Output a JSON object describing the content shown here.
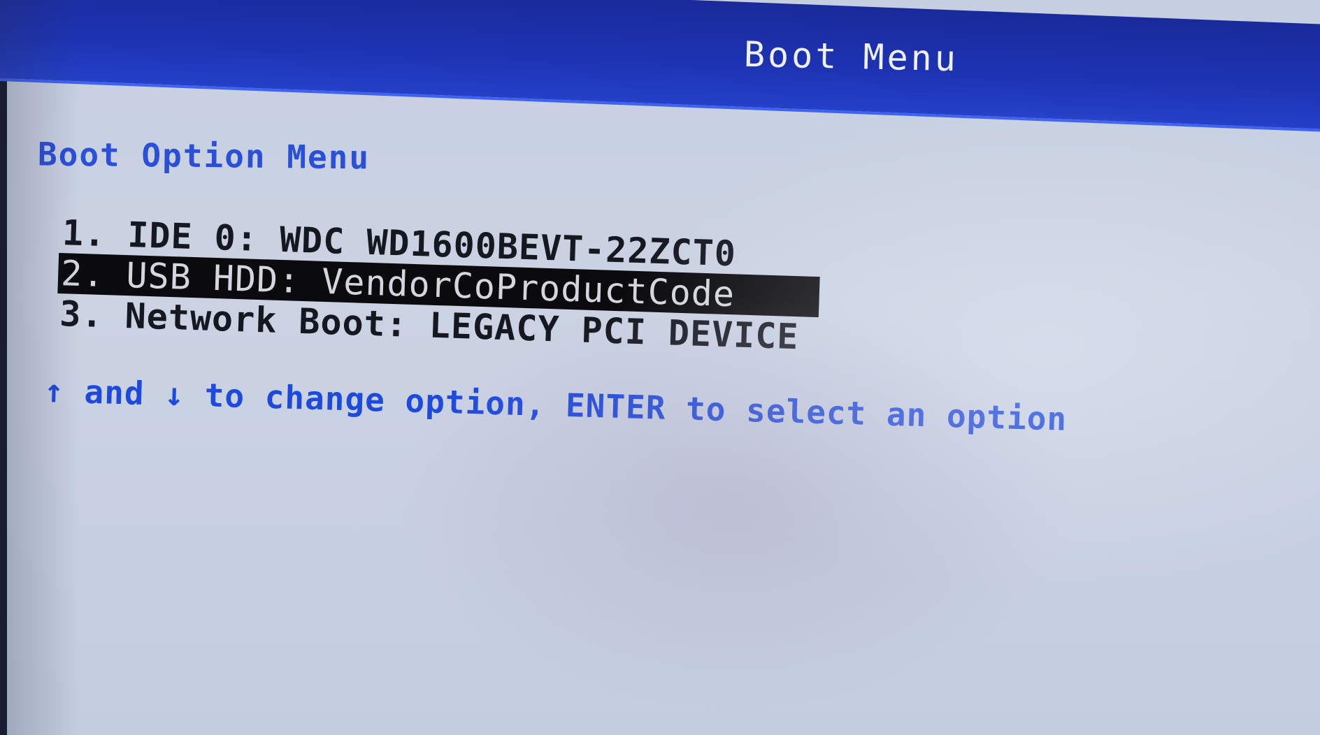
{
  "window": {
    "title": "Boot Menu"
  },
  "menu": {
    "heading": "Boot Option Menu",
    "options": [
      {
        "index": "1.",
        "label": "IDE 0: WDC WD1600BEVT-22ZCT0",
        "selected": false
      },
      {
        "index": "2.",
        "label": "USB HDD: VendorCoProductCode",
        "selected": true
      },
      {
        "index": "3.",
        "label": "Network Boot: LEGACY PCI DEVICE",
        "selected": false
      }
    ]
  },
  "help": {
    "up_arrow": "↑",
    "and": "and",
    "down_arrow": "↓",
    "text": "to change option, ENTER to select an option"
  },
  "colors": {
    "title_bar": "#1d33b3",
    "title_text": "#eef0ff",
    "screen_bg": "#c8d0e1",
    "heading": "#2a4fd8",
    "option_text": "#161820",
    "selection_bg": "#0b0b0e",
    "selection_text": "#d3d6de",
    "help_text": "#1e49dd"
  }
}
